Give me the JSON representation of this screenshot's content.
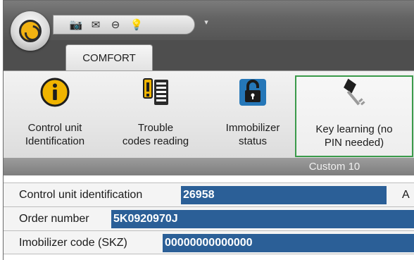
{
  "window": {
    "quick_access": [
      {
        "icon": "camera-icon",
        "glyph": "📷"
      },
      {
        "icon": "mail-icon",
        "glyph": "✉"
      },
      {
        "icon": "minus-circle-icon",
        "glyph": "⊖"
      },
      {
        "icon": "lightbulb-icon",
        "glyph": "💡"
      }
    ],
    "qat_dropdown_glyph": "▾"
  },
  "tabs": [
    {
      "label": "COMFORT",
      "active": true
    }
  ],
  "ribbon": {
    "buttons": [
      {
        "label_line1": "Control unit",
        "label_line2": "Identification",
        "icon": "info-icon"
      },
      {
        "label_line1": "Trouble",
        "label_line2": "codes reading",
        "icon": "trouble-codes-icon"
      },
      {
        "label_line1": "Immobilizer",
        "label_line2": "status",
        "icon": "padlock-icon"
      },
      {
        "label_line1": "Key learning (no",
        "label_line2": "PIN needed)",
        "icon": "key-icon",
        "selected": true
      }
    ],
    "group_label": "Custom 10"
  },
  "fields": [
    {
      "label": "Control unit identification",
      "value": "26958",
      "extra": "A"
    },
    {
      "label": "Order number",
      "value": "5K0920970J"
    },
    {
      "label": "Imobilizer code (SKZ)",
      "value": "00000000000000"
    }
  ],
  "colors": {
    "value_highlight": "#2b5f97",
    "selected_border": "#3a9a4a",
    "orb_accent": "#f1b212"
  }
}
